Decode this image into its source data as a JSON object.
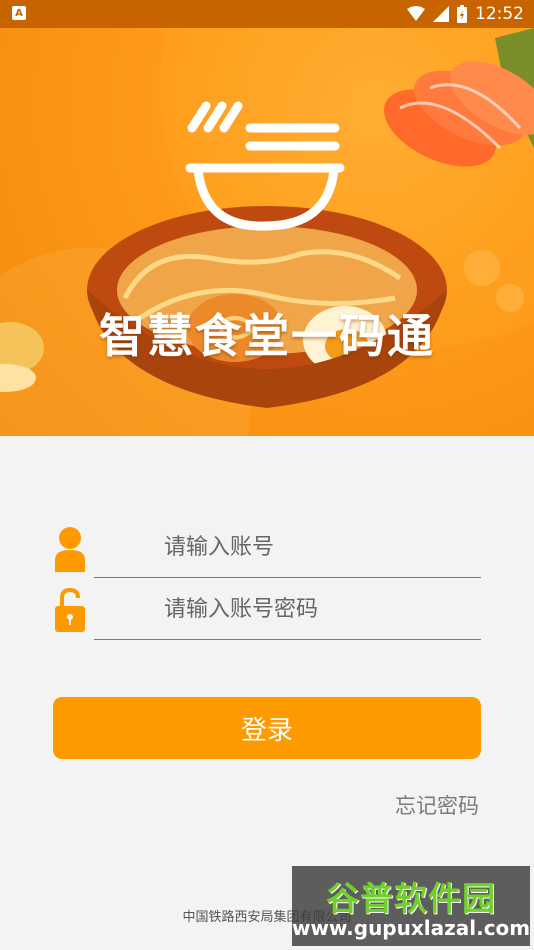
{
  "status_bar": {
    "time": "12:52",
    "icons": [
      "notification-icon",
      "wifi-icon",
      "signal-icon",
      "battery-icon"
    ]
  },
  "hero": {
    "title": "智慧食堂一码通"
  },
  "login_form": {
    "account_placeholder": "请输入账号",
    "password_placeholder": "请输入账号密码",
    "login_label": "登录",
    "forgot_label": "忘记密码"
  },
  "footer": {
    "company": "中国铁路西安局集团有限公司"
  },
  "watermark": {
    "title": "谷普软件园",
    "url": "www.gupuxlazal.com"
  },
  "colors": {
    "accent": "#fd9a00",
    "status_bar": "#c86400"
  }
}
